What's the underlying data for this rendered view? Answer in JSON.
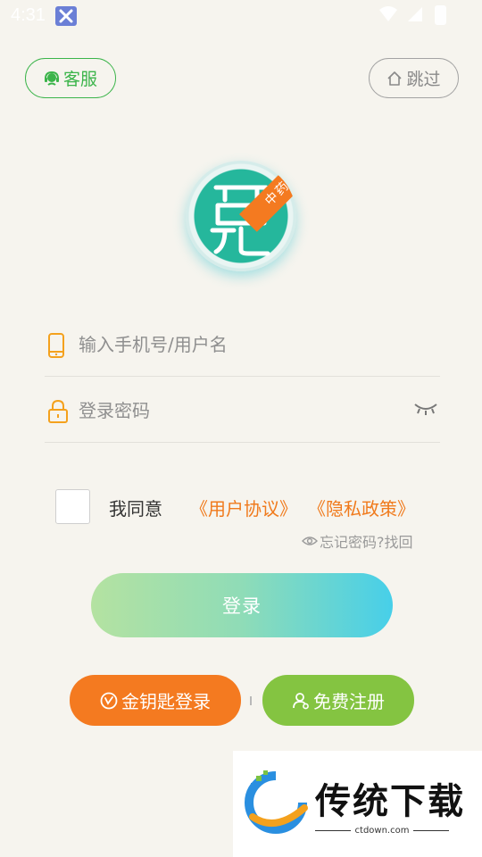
{
  "status_bar": {
    "time": "4:31"
  },
  "top": {
    "service_label": "客服",
    "skip_label": "跳过"
  },
  "logo": {
    "badge_text": "中药士"
  },
  "form": {
    "phone_placeholder": "输入手机号/用户名",
    "password_placeholder": "登录密码"
  },
  "agreement": {
    "prefix": "我同意",
    "user_agreement": "《用户协议》",
    "privacy_policy": "《隐私政策》"
  },
  "forgot_label": "忘记密码?找回",
  "login_label": "登录",
  "bottom": {
    "golden_key_label": "金钥匙登录",
    "register_label": "免费注册"
  },
  "watermark": {
    "title": "传统下载",
    "site": "ctdown.com"
  },
  "colors": {
    "accent_green": "#3bb44a",
    "accent_orange": "#f47a20",
    "register_green": "#84c441",
    "background": "#f6f4ee"
  }
}
